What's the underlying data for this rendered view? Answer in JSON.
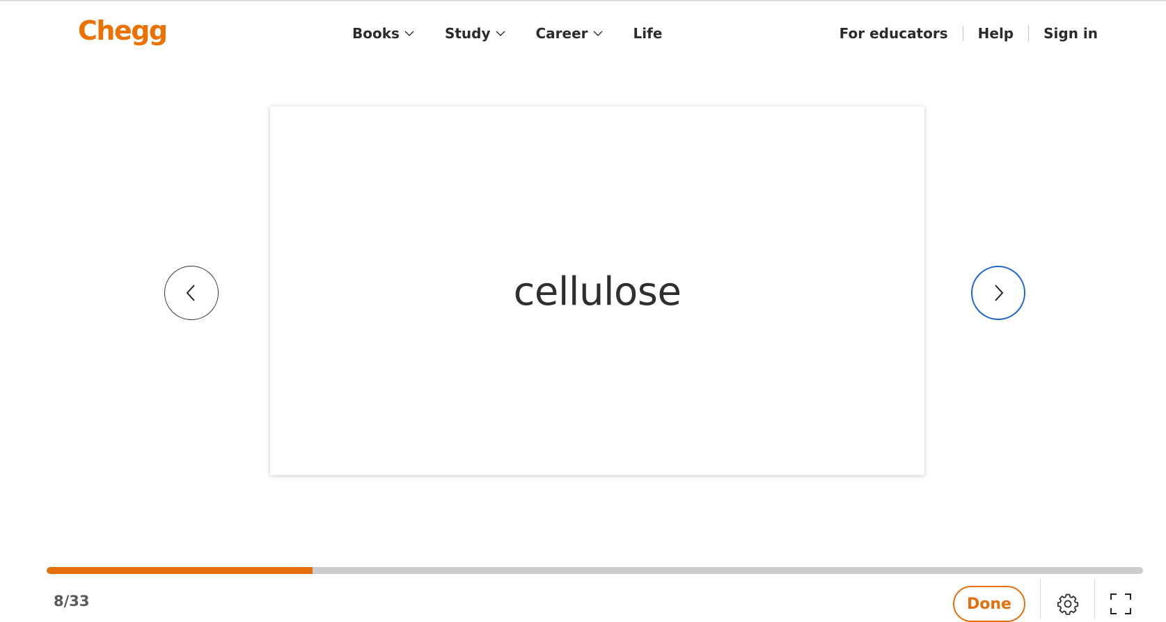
{
  "header": {
    "logo": "Chegg",
    "nav": [
      {
        "label": "Books",
        "has_dropdown": true
      },
      {
        "label": "Study",
        "has_dropdown": true
      },
      {
        "label": "Career",
        "has_dropdown": true
      },
      {
        "label": "Life",
        "has_dropdown": false
      }
    ],
    "right_links": [
      "For educators",
      "Help",
      "Sign in"
    ]
  },
  "flashcard": {
    "term": "cellulose"
  },
  "controls": {
    "prev_icon": "chevron-left-icon",
    "next_icon": "chevron-right-icon",
    "settings_icon": "gear-icon",
    "fullscreen_icon": "fullscreen-icon"
  },
  "progress": {
    "current": 8,
    "total": 33,
    "label": "8/33"
  },
  "footer": {
    "done_label": "Done"
  },
  "colors": {
    "brand": "#eb7100",
    "progress_fill": "#e56f0b",
    "progress_track": "#cccccc",
    "next_ring": "#1a66c9"
  }
}
